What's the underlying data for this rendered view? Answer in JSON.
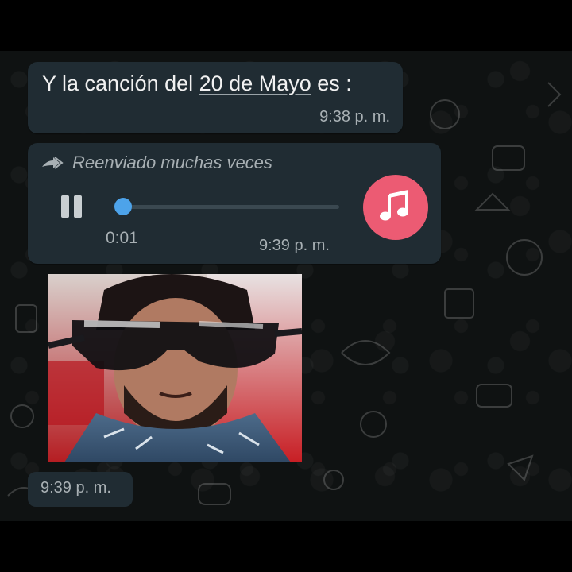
{
  "messages": [
    {
      "type": "text",
      "text_before": "Y la canción del ",
      "link_text": "20 de Mayo",
      "text_after": " es :",
      "time": "9:38 p. m."
    },
    {
      "type": "audio",
      "forwarded_label": "Reenviado muchas veces",
      "duration": "0:01",
      "progress": 0.03,
      "time": "9:39 p. m.",
      "state": "playing"
    },
    {
      "type": "image",
      "time": "9:39 p. m."
    }
  ],
  "icons": {
    "forward": "double-arrow-forward-icon",
    "pause": "pause-icon",
    "music": "music-note-icon"
  },
  "colors": {
    "bubble": "#202c33",
    "accent_blue": "#4da3ea",
    "music_badge": "#ec5b73",
    "chat_background": "#0f1212"
  }
}
